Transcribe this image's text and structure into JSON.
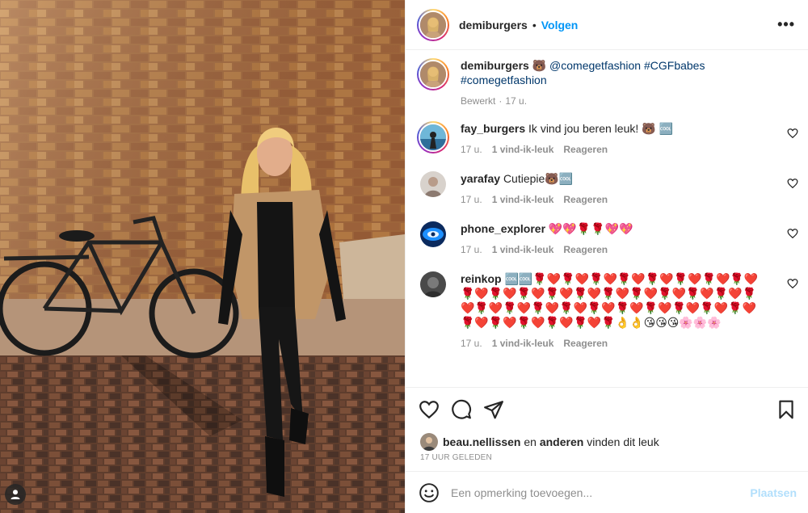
{
  "header": {
    "username": "demiburgers",
    "separator": "•",
    "follow_label": "Volgen",
    "more_label": "•••"
  },
  "caption": {
    "username": "demiburgers",
    "text_prefix": "🐻 ",
    "mention": "@comegetfashion",
    "tag1": "#CGFbabes",
    "tag2": "#comegetfashion",
    "edited": "Bewerkt",
    "dot": "·",
    "time": "17 u."
  },
  "comments": [
    {
      "username": "fay_burgers",
      "text": "Ik vind jou beren leuk! 🐻 🆒",
      "time": "17 u.",
      "likes": "1 vind-ik-leuk",
      "reply": "Reageren"
    },
    {
      "username": "yarafay",
      "text": "Cutiepie🐻🆒",
      "time": "17 u.",
      "likes": "1 vind-ik-leuk",
      "reply": "Reageren"
    },
    {
      "username": "phone_explorer",
      "text": "💖💖🌹🌹💖💖",
      "time": "17 u.",
      "likes": "1 vind-ik-leuk",
      "reply": "Reageren"
    },
    {
      "username": "reinkop",
      "text": "🆒🆒🌹❤️🌹❤️🌹❤️🌹❤️🌹❤️🌹❤️🌹❤️🌹❤️🌹❤️🌹❤️🌹❤️🌹❤️🌹❤️🌹❤️🌹❤️🌹❤️🌹❤️🌹❤️🌹❤️🌹❤️🌹❤️🌹❤️🌹❤️🌹❤️🌹❤️🌹❤️🌹❤️🌹❤️🌹❤️🌹❤️🌹❤️🌹❤️🌹❤️🌹❤️🌹👌👌😘😘😘🌸🌸🌸",
      "time": "17 u.",
      "likes": "1 vind-ik-leuk",
      "reply": "Reageren"
    }
  ],
  "likes": {
    "user": "beau.nellissen",
    "and": " en ",
    "others": "anderen",
    "suffix": " vinden dit leuk"
  },
  "timestamp": "17 UUR GELEDEN",
  "composer": {
    "placeholder": "Een opmerking toevoegen...",
    "post_label": "Plaatsen"
  },
  "colors": {
    "follow": "#0095f6",
    "hashtag": "#00376b",
    "muted": "#8e8e8e",
    "post_disabled": "#b2dffc"
  },
  "icons": [
    "user-tag-icon",
    "more-icon",
    "heart-icon",
    "comment-icon",
    "share-icon",
    "bookmark-icon",
    "emoji-icon"
  ]
}
